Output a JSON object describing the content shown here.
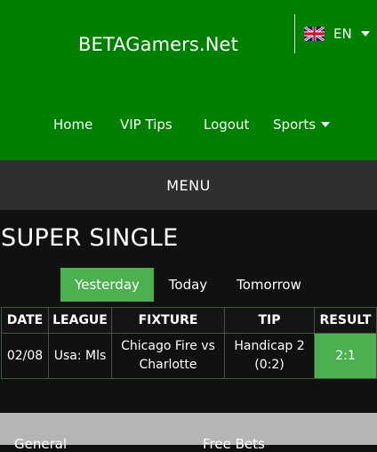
{
  "header": {
    "brand": "BETAGamers.Net",
    "language": {
      "code": "EN",
      "flag_icon": "uk-flag-icon"
    }
  },
  "nav": {
    "items": [
      {
        "label": "Home"
      },
      {
        "label": "VIP Tips"
      },
      {
        "label": "Logout"
      },
      {
        "label": "Sports",
        "has_dropdown": true
      }
    ]
  },
  "menu": {
    "label": "MENU"
  },
  "section": {
    "title": "SUPER SINGLE"
  },
  "tabs": [
    {
      "label": "Yesterday",
      "active": true
    },
    {
      "label": "Today",
      "active": false
    },
    {
      "label": "Tomorrow",
      "active": false
    }
  ],
  "table": {
    "headers": [
      "DATE",
      "LEAGUE",
      "FIXTURE",
      "TIP",
      "RESULT"
    ],
    "rows": [
      {
        "date": "02/08",
        "league": "Usa: Mls",
        "fixture": "Chicago Fire vs Charlotte",
        "tip": "Handicap 2 (0:2)",
        "result": "2:1"
      }
    ]
  },
  "footer": {
    "left": "General",
    "right": "Free Bets"
  },
  "colors": {
    "header_green": "#008000",
    "accent_green": "#4caf50",
    "menu_bar": "#2f2f2f",
    "background": "#111111"
  }
}
